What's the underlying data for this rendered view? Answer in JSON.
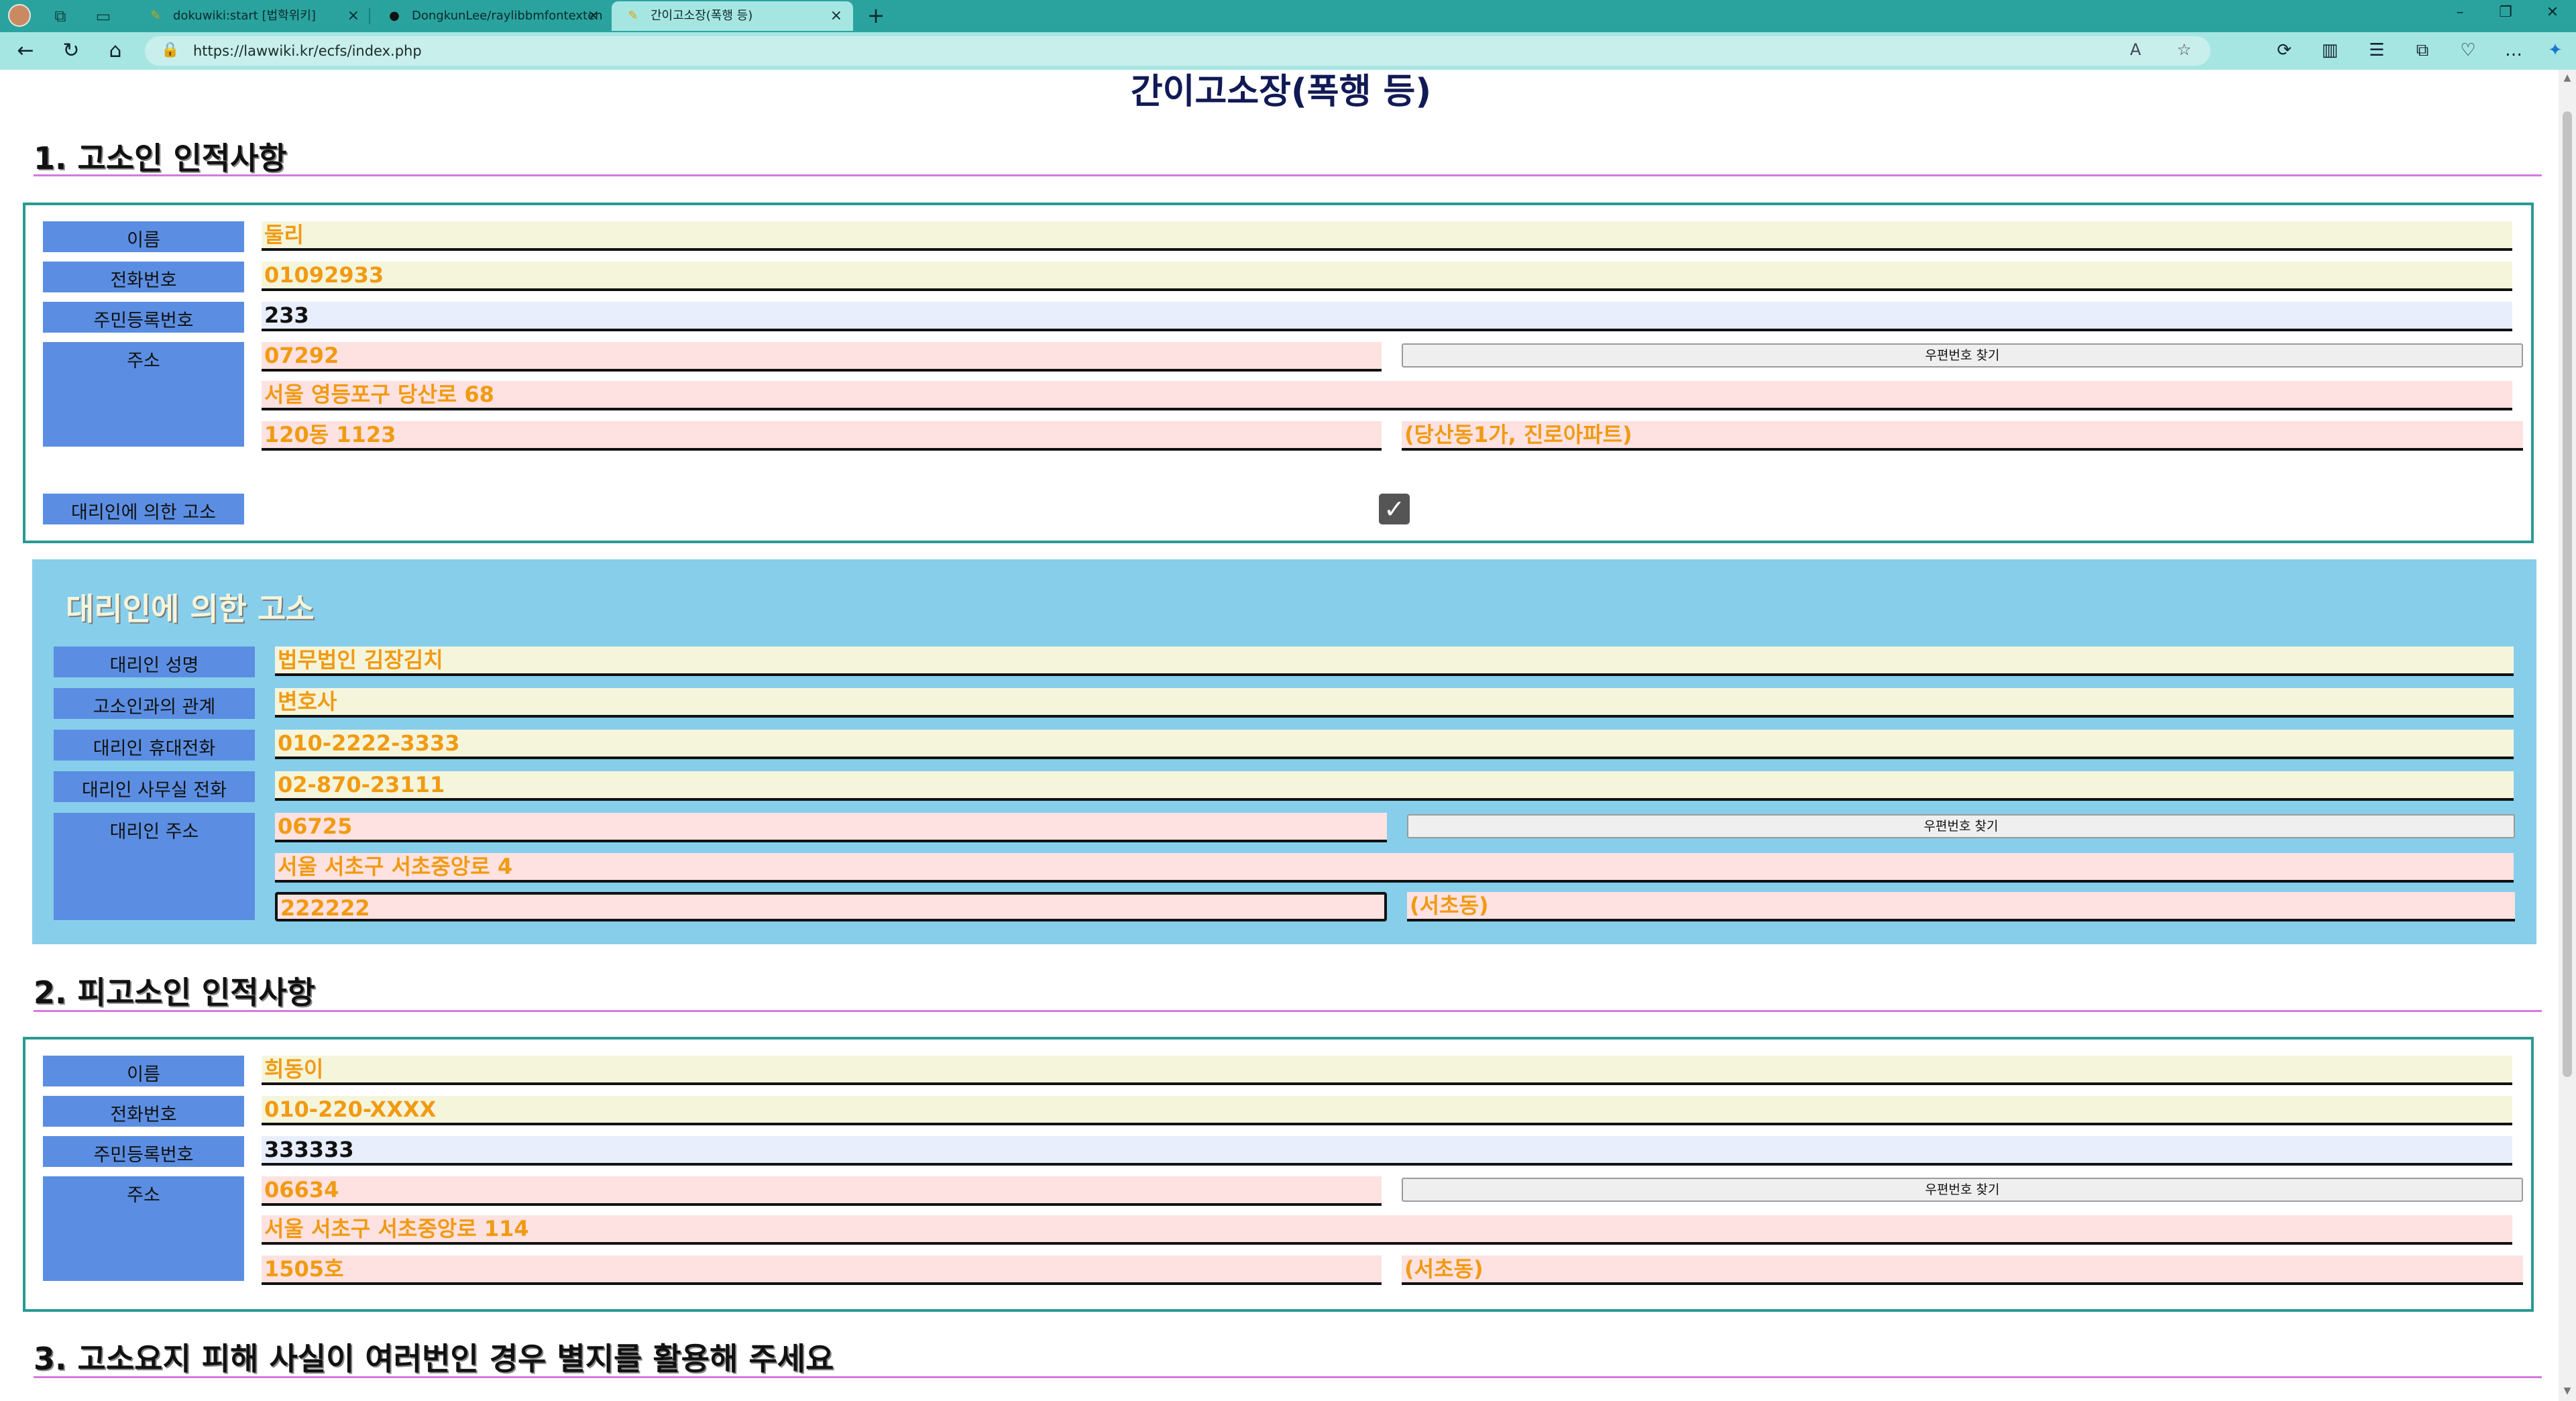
{
  "browser": {
    "tabs": [
      {
        "label": "dokuwiki:start [법학위키]",
        "icon": "dokuwiki-icon"
      },
      {
        "label": "DongkunLee/raylibbmfontexten",
        "icon": "github-icon"
      },
      {
        "label": "간이고소장(폭행 등)",
        "icon": "dokuwiki-icon",
        "active": true
      }
    ],
    "url": "https://lawwiki.kr/ecfs/index.php"
  },
  "page": {
    "title": "간이고소장(폭행 등)",
    "section1": {
      "heading": "1. 고소인 인적사항",
      "labels": {
        "name": "이름",
        "phone": "전화번호",
        "rrn": "주민등록번호",
        "address": "주소",
        "proxy": "대리인에 의한 고소"
      },
      "values": {
        "name": "둘리",
        "phone": "01092933",
        "rrn": "233",
        "zip": "07292",
        "addr1": "서울 영등포구 당산로 68",
        "addr2": "120동 1123",
        "addr_extra": "(당산동1가, 진로아파트)"
      },
      "zip_button": "우편번호 찾기",
      "proxy_checked": true
    },
    "proxy_box": {
      "title": "대리인에 의한 고소",
      "labels": {
        "name": "대리인 성명",
        "relation": "고소인과의 관계",
        "mobile": "대리인 휴대전화",
        "office_phone": "대리인 사무실 전화",
        "address": "대리인 주소"
      },
      "values": {
        "name": "법무법인 김장김치",
        "relation": "변호사",
        "mobile": "010-2222-3333",
        "office_phone": "02-870-23111",
        "zip": "06725",
        "addr1": "서울 서초구 서초중앙로 4",
        "addr2": "222222",
        "addr_extra": "(서초동)"
      },
      "zip_button": "우편번호 찾기"
    },
    "section2": {
      "heading": "2. 피고소인 인적사항",
      "labels": {
        "name": "이름",
        "phone": "전화번호",
        "rrn": "주민등록번호",
        "address": "주소"
      },
      "values": {
        "name": "희동이",
        "phone": "010-220-XXXX",
        "rrn": "333333",
        "zip": "06634",
        "addr1": "서울 서초구 서초중앙로 114",
        "addr2": "1505호",
        "addr_extra": "(서초동)"
      },
      "zip_button": "우편번호 찾기"
    },
    "section3": {
      "heading": "3. 고소요지 피해 사실이 여러번인 경우 별지를 활용해 주세요"
    }
  },
  "colors": {
    "tabbar": "#2aa39f",
    "toolbar": "#a6e6e2",
    "label_bg": "#5b8ee2",
    "value_text": "#f19a12",
    "proxy_bg": "#87ceeb",
    "rule": "#d57ade"
  }
}
